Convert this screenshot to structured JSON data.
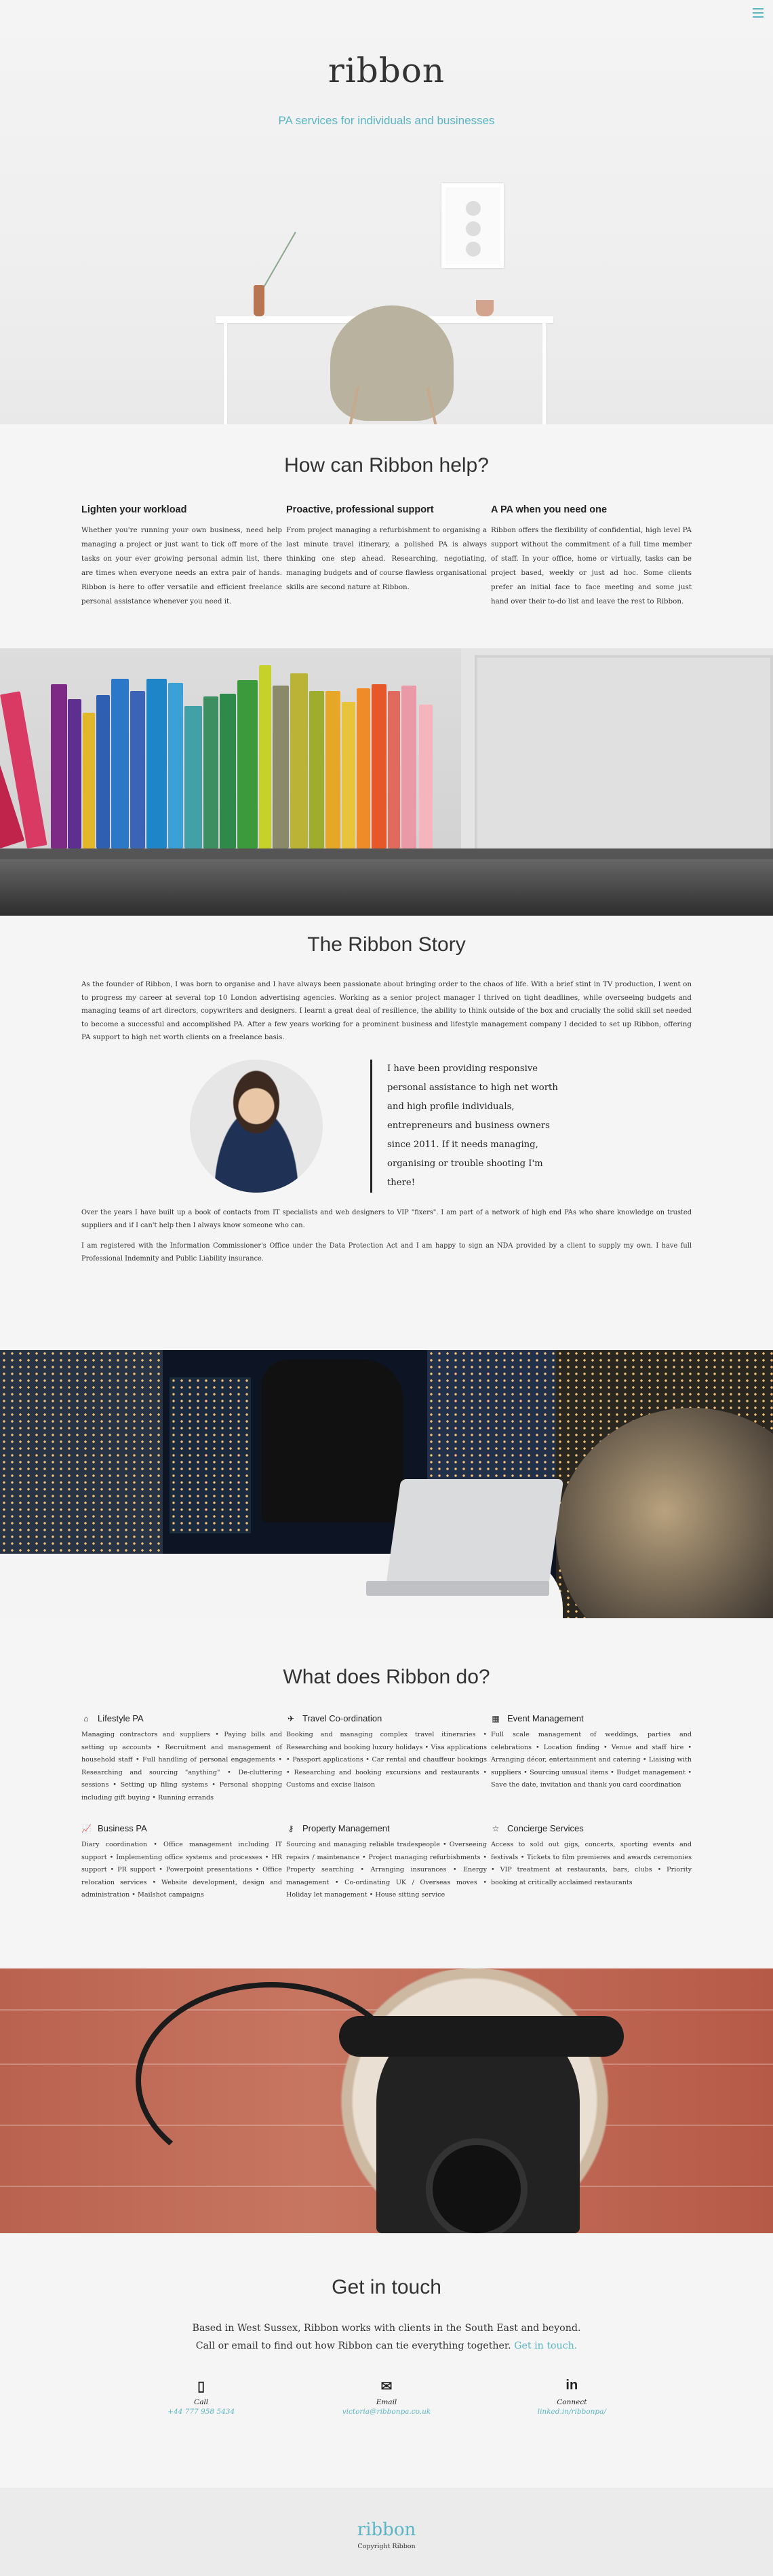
{
  "hero": {
    "logo": "ribbon",
    "tagline": "PA services for individuals and businesses"
  },
  "help": {
    "title": "How can Ribbon help?",
    "columns": [
      {
        "heading": "Lighten your workload",
        "text": "Whether you're running your own business, need help managing a project or just want to tick off more of the tasks on your ever growing personal admin list, there are times when everyone needs an extra pair of hands. Ribbon is here to offer versatile and efficient freelance personal assistance whenever you need it."
      },
      {
        "heading": "Proactive, professional support",
        "text": "From project managing a refurbishment to organising a last minute travel itinerary, a polished PA is always thinking one step ahead. Researching, negotiating, managing budgets and of course flawless organisational skills are second nature at Ribbon."
      },
      {
        "heading": "A PA when you need one",
        "text": "Ribbon offers the flexibility of confidential, high level PA support without the commitment of a full time member of staff. In your office, home or virtually, tasks can be project based, weekly or just ad hoc. Some clients prefer an initial face to face meeting and some just hand over their to-do list and leave the rest to Ribbon."
      }
    ]
  },
  "story": {
    "title": "The Ribbon Story",
    "intro": "As the founder of Ribbon, I was born to organise and I have always been passionate about bringing order to the chaos of life. With a brief stint in TV production, I went on to progress my career at several top 10 London advertising agencies. Working as a senior project manager I thrived on tight deadlines, while overseeing budgets and managing teams of art directors, copywriters and designers. I learnt a great deal of resilience, the ability to think outside of the box and crucially the solid skill set needed to become a successful and accomplished PA. After a few years working for a prominent business and lifestyle management company I decided to set up Ribbon, offering PA support to high net worth clients on a freelance basis.",
    "quote": "I have been providing responsive personal assistance to high net worth and high profile individuals, entrepreneurs and business owners since 2011. If it needs managing, organising or trouble shooting I'm there!",
    "para2": "Over the years I have built up a book of contacts from IT specialists and web designers to VIP \"fixers\". I am part of a network of high end PAs who share knowledge on trusted suppliers and if I can't help then I always know someone who can.",
    "para3": "I am registered with the Information Commissioner's Office under the Data Protection Act and I am happy to sign an NDA provided by a client to supply my own. I have full Professional Indemnity and Public Liability insurance."
  },
  "what": {
    "title": "What does Ribbon do?",
    "services": [
      {
        "icon": "home-icon",
        "glyph": "⌂",
        "title": "Lifestyle PA",
        "text": "Managing contractors and suppliers • Paying bills and setting up accounts • Recruitment and management of household staff • Full handling of personal engagements • Researching and sourcing \"anything\" • De-cluttering sessions • Setting up filing systems • Personal shopping including gift buying • Running errands"
      },
      {
        "icon": "plane-icon",
        "glyph": "✈",
        "title": "Travel Co-ordination",
        "text": "Booking and managing complex travel itineraries • Researching and booking luxury holidays • Visa applications • Passport applications • Car rental and chauffeur bookings • Researching and booking excursions and restaurants • Customs and excise liaison"
      },
      {
        "icon": "calendar-icon",
        "glyph": "▦",
        "title": "Event Management",
        "text": "Full scale management of weddings, parties and celebrations • Location finding • Venue and staff hire • Arranging décor, entertainment and catering • Liaising with suppliers • Sourcing unusual items • Budget management • Save the date, invitation and thank you card coordination"
      },
      {
        "icon": "chart-icon",
        "glyph": "📈",
        "title": "Business PA",
        "text": "Diary coordination • Office management including IT support • Implementing office systems and processes • HR support • PR support • Powerpoint presentations • Office relocation services • Website development, design and administration • Mailshot campaigns"
      },
      {
        "icon": "key-icon",
        "glyph": "⚷",
        "title": "Property Management",
        "text": "Sourcing and managing reliable tradespeople • Overseeing repairs / maintenance • Project managing refurbishments • Property searching • Arranging insurances • Energy management • Co-ordinating UK / Overseas moves • Holiday let management • House sitting service"
      },
      {
        "icon": "star-icon",
        "glyph": "☆",
        "title": "Concierge Services",
        "text": "Access to sold out gigs, concerts, sporting events and festivals • Tickets to film premieres and awards ceremonies • VIP treatment at restaurants, bars, clubs • Priority booking at critically acclaimed restaurants"
      }
    ]
  },
  "contact": {
    "title": "Get in touch",
    "intro": "Based in West Sussex, Ribbon works with clients in the South East and beyond. Call or email to find out how Ribbon can tie everything together.",
    "intro_link": "Get in touch.",
    "methods": [
      {
        "icon": "phone-icon",
        "glyph": "▯",
        "label": "Call",
        "value": "+44 777 958 5434"
      },
      {
        "icon": "envelope-icon",
        "glyph": "✉",
        "label": "Email",
        "value": "victoria@ribbonpa.co.uk"
      },
      {
        "icon": "linkedin-icon",
        "glyph": "in",
        "label": "Connect",
        "value": "linked.in/ribbonpa/"
      }
    ]
  },
  "footer": {
    "logo": "ribbon",
    "copyright": "Copyright Ribbon"
  },
  "colors": {
    "accent": "#5ab6c4",
    "background": "#f5f5f5"
  }
}
